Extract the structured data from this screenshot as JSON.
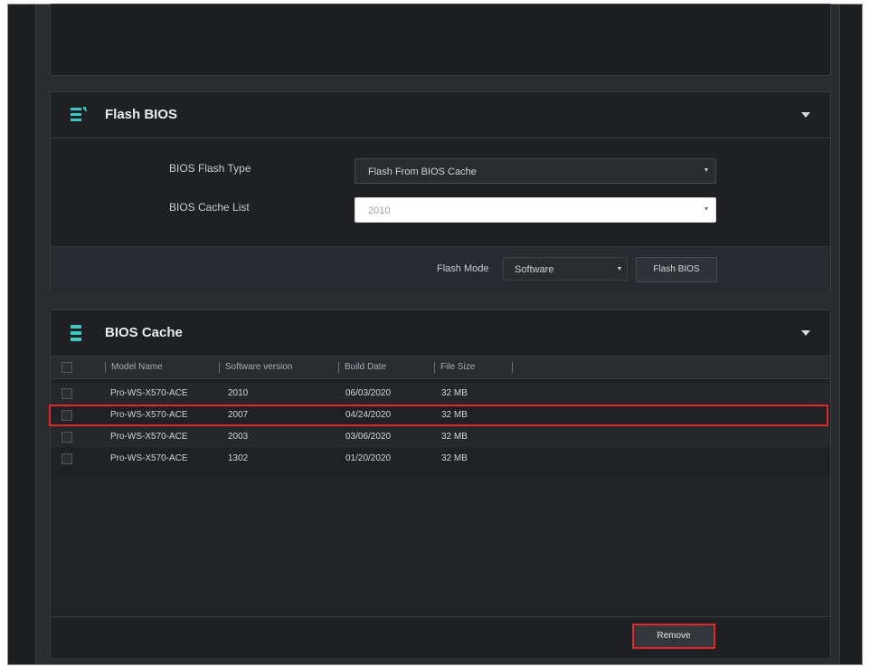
{
  "flash_bios": {
    "title": "Flash BIOS",
    "bios_flash_type_label": "BIOS Flash Type",
    "bios_flash_type_value": "Flash From BIOS Cache",
    "bios_cache_list_label": "BIOS Cache List",
    "bios_cache_list_value": "2010",
    "flash_mode_label": "Flash Mode",
    "flash_mode_value": "Software",
    "flash_button": "Flash BIOS"
  },
  "bios_cache": {
    "title": "BIOS Cache",
    "columns": [
      "Model Name",
      "Software version",
      "Build Date",
      "File Size"
    ],
    "rows": [
      {
        "model": "Pro-WS-X570-ACE",
        "version": "2010",
        "date": "06/03/2020",
        "size": "32 MB"
      },
      {
        "model": "Pro-WS-X570-ACE",
        "version": "2007",
        "date": "04/24/2020",
        "size": "32 MB"
      },
      {
        "model": "Pro-WS-X570-ACE",
        "version": "2003",
        "date": "03/06/2020",
        "size": "32 MB"
      },
      {
        "model": "Pro-WS-X570-ACE",
        "version": "1302",
        "date": "01/20/2020",
        "size": "32 MB"
      }
    ],
    "remove_button": "Remove"
  },
  "colors": {
    "accent_highlight": "#e0282b",
    "icon_teal": "#3ec7c2"
  },
  "icons": {
    "flash_panel": "bios-settings-icon",
    "cache_panel": "bios-cache-icon",
    "expand": "chevron-down-icon"
  }
}
